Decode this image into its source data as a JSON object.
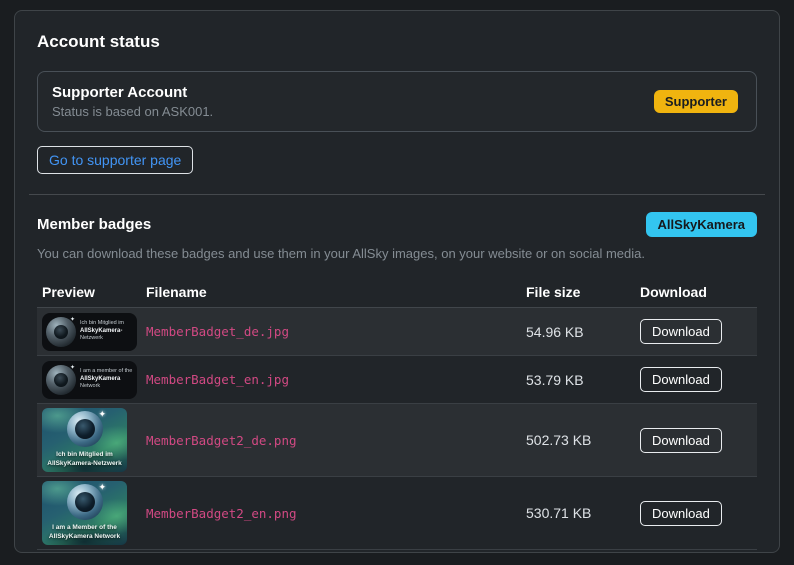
{
  "colors": {
    "page_bg": "#1a1d20",
    "card_bg": "#212529",
    "supporter_badge": "#f0b40f",
    "camera_badge": "#33c5f0",
    "filename_text": "#d14983",
    "link_text": "#4295f5"
  },
  "account_status": {
    "title": "Account status",
    "box": {
      "title": "Supporter Account",
      "subtitle": "Status is based on ASK001.",
      "badge": "Supporter"
    },
    "link_label": "Go to supporter page"
  },
  "member_badges": {
    "title": "Member badges",
    "badge": "AllSkyKamera",
    "description": "You can download these badges and use them in your AllSky images, on your website or on social media.",
    "table": {
      "headers": [
        "Preview",
        "Filename",
        "File size",
        "Download"
      ],
      "rows": [
        {
          "preview": {
            "style": "small",
            "lines": [
              "Ich bin Mitglied im",
              "AllSkyKamera-",
              "Netzwerk"
            ]
          },
          "filename": "MemberBadget_de.jpg",
          "filesize": "54.96 KB",
          "download_label": "Download"
        },
        {
          "preview": {
            "style": "small",
            "lines": [
              "I am a member of the",
              "AllSkyKamera",
              "Network"
            ]
          },
          "filename": "MemberBadget_en.jpg",
          "filesize": "53.79 KB",
          "download_label": "Download"
        },
        {
          "preview": {
            "style": "large",
            "lines": [
              "Ich bin Mitglied im",
              "AllSkyKamera-Netzwerk"
            ]
          },
          "filename": "MemberBadget2_de.png",
          "filesize": "502.73 KB",
          "download_label": "Download"
        },
        {
          "preview": {
            "style": "large",
            "lines": [
              "I am a Member of the",
              "AllSkyKamera Network"
            ]
          },
          "filename": "MemberBadget2_en.png",
          "filesize": "530.71 KB",
          "download_label": "Download"
        }
      ]
    }
  },
  "icons": {
    "sparkle": "✦"
  }
}
